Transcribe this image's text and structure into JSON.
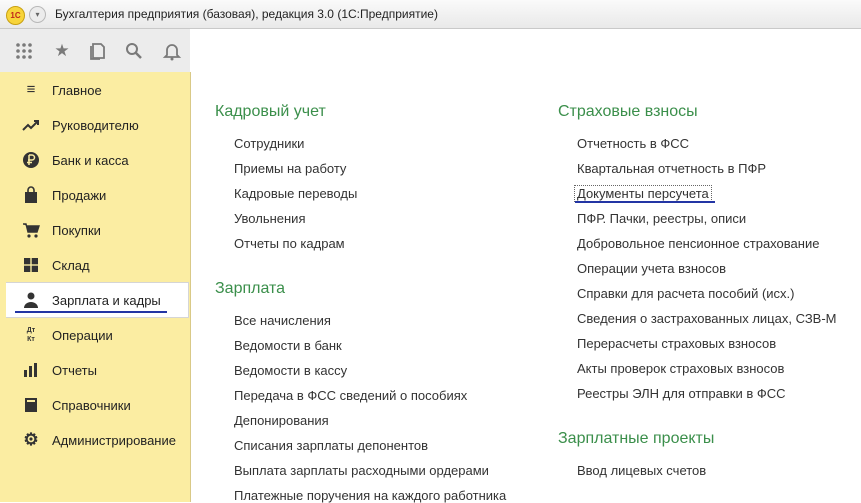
{
  "window": {
    "title": "Бухгалтерия предприятия (базовая), редакция 3.0  (1С:Предприятие)",
    "logo_text": "1С"
  },
  "toolbar": {
    "icons": [
      "apps-grid-icon",
      "star-icon",
      "history-icon",
      "search-icon",
      "bell-icon"
    ]
  },
  "sidebar": {
    "items": [
      {
        "label": "Главное",
        "icon": "menu-lines-icon"
      },
      {
        "label": "Руководителю",
        "icon": "trend-icon"
      },
      {
        "label": "Банк и касса",
        "icon": "ruble-icon"
      },
      {
        "label": "Продажи",
        "icon": "bag-icon"
      },
      {
        "label": "Покупки",
        "icon": "cart-icon"
      },
      {
        "label": "Склад",
        "icon": "warehouse-icon"
      },
      {
        "label": "Зарплата и кадры",
        "icon": "person-icon"
      },
      {
        "label": "Операции",
        "icon": "dt-kt-icon"
      },
      {
        "label": "Отчеты",
        "icon": "bar-chart-icon"
      },
      {
        "label": "Справочники",
        "icon": "book-icon"
      },
      {
        "label": "Администрирование",
        "icon": "gear-icon"
      }
    ],
    "active_index": 6,
    "dt_kt_text": "Дт Кт"
  },
  "main": {
    "left": {
      "sections": [
        {
          "title": "Кадровый учет",
          "links": [
            "Сотрудники",
            "Приемы на работу",
            "Кадровые переводы",
            "Увольнения",
            "Отчеты по кадрам"
          ]
        },
        {
          "title": "Зарплата",
          "links": [
            "Все начисления",
            "Ведомости в банк",
            "Ведомости в кассу",
            "Передача в ФСС сведений о пособиях",
            "Депонирования",
            "Списания зарплаты депонентов",
            "Выплата зарплаты расходными ордерами",
            "Платежные поручения на каждого работника"
          ]
        }
      ]
    },
    "right": {
      "sections": [
        {
          "title": "Страховые взносы",
          "links": [
            "Отчетность в ФСС",
            "Квартальная отчетность в ПФР",
            "Документы персучета",
            "ПФР. Пачки, реестры, описи",
            "Добровольное пенсионное страхование",
            "Операции учета взносов",
            "Справки для расчета пособий (исх.)",
            "Сведения о застрахованных лицах, СЗВ-М",
            "Перерасчеты страховых взносов",
            "Акты проверок страховых взносов",
            "Реестры ЭЛН для отправки в ФСС"
          ]
        },
        {
          "title": "Зарплатные проекты",
          "links": [
            "Ввод лицевых счетов"
          ]
        }
      ],
      "focused_link": "Документы персучета"
    }
  },
  "colors": {
    "sidebar_bg": "#fbeda2",
    "section_title": "#3b8f4b",
    "underline": "#2335a4"
  }
}
